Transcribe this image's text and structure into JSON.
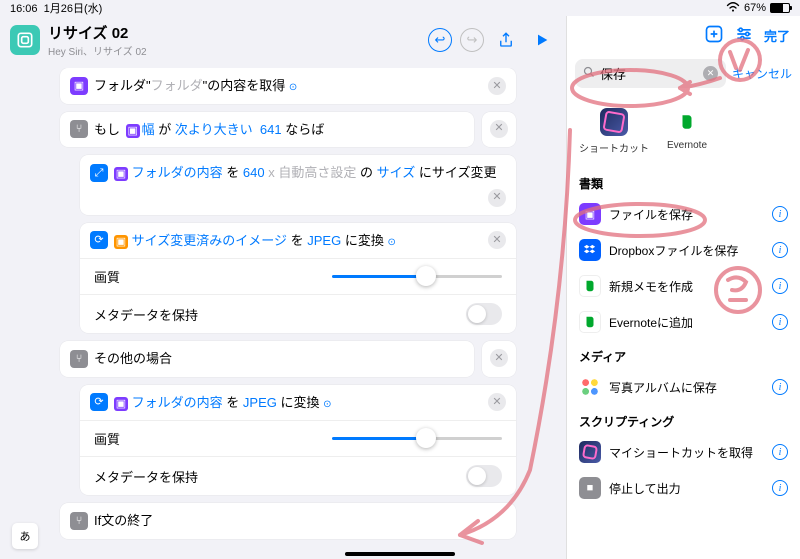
{
  "status": {
    "time": "16:06",
    "date": "1月26日(水)",
    "battery": "67%"
  },
  "header": {
    "title": "リサイズ 02",
    "subtitle": "Hey Siri、リサイズ 02"
  },
  "actions": {
    "a1": {
      "pre": "フォルダ\"",
      "placeholder": "フォルダ",
      "post": "\"の内容を取得"
    },
    "a2": {
      "t1": "もし",
      "var": "幅",
      "t2": "が",
      "cond": "次より大きい",
      "val": "641",
      "t3": "ならば"
    },
    "a3": {
      "var": "フォルダの内容",
      "t1": "を",
      "w": "640",
      "x": "x",
      "h": "自動高さ設定",
      "t2": "の",
      "size": "サイズ",
      "t3": "にサイズ変更"
    },
    "a4": {
      "var": "サイズ変更済みのイメージ",
      "t1": "を",
      "fmt": "JPEG",
      "t2": "に変換"
    },
    "quality": "画質",
    "meta": "メタデータを保持",
    "else": "その他の場合",
    "a5": {
      "var": "フォルダの内容",
      "t1": "を",
      "fmt": "JPEG",
      "t2": "に変換"
    },
    "endif": "If文の終了"
  },
  "panel": {
    "done": "完了",
    "search_value": "保存",
    "cancel": "キャンセル",
    "apps": {
      "shortcuts": "ショートカット",
      "evernote": "Evernote"
    },
    "sec1": "書類",
    "r1": "ファイルを保存",
    "r2": "Dropboxファイルを保存",
    "r3": "新規メモを作成",
    "r4": "Evernoteに追加",
    "sec2": "メディア",
    "r5": "写真アルバムに保存",
    "sec3": "スクリプティング",
    "r6": "マイショートカットを取得",
    "r7": "停止して出力"
  },
  "kbd": "あ"
}
